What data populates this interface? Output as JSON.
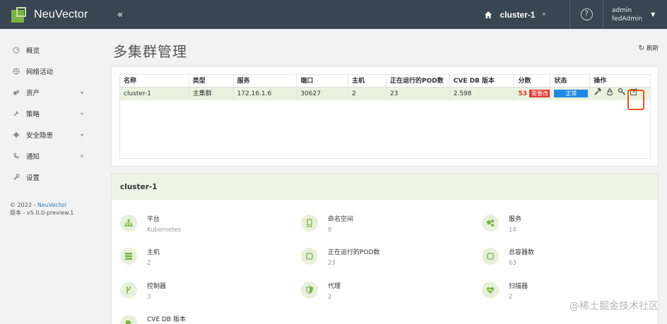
{
  "app": {
    "name": "NeuVector",
    "collapse_glyph": "«"
  },
  "topbar": {
    "cluster": "cluster-1",
    "help_glyph": "?",
    "user": "admin",
    "role": "fedAdmin"
  },
  "sidebar": {
    "items": [
      {
        "label": "概览",
        "icon": "dashboard-icon",
        "expandable": false
      },
      {
        "label": "网络活动",
        "icon": "network-icon",
        "expandable": false
      },
      {
        "label": "资产",
        "icon": "assets-icon",
        "expandable": true
      },
      {
        "label": "策略",
        "icon": "policy-icon",
        "expandable": true
      },
      {
        "label": "安全隐患",
        "icon": "security-icon",
        "expandable": true
      },
      {
        "label": "通知",
        "icon": "notification-icon",
        "expandable": true
      },
      {
        "label": "设置",
        "icon": "settings-icon",
        "expandable": false
      }
    ],
    "footer": {
      "copyright": "© 2022 -",
      "company": "NeuVector",
      "version": "版本 - v5.0.0-preview.1"
    }
  },
  "page": {
    "title": "多集群管理",
    "refresh_label": "刷新"
  },
  "cluster_table": {
    "columns": [
      "名称",
      "类型",
      "服务",
      "端口",
      "主机",
      "正在运行的POD数",
      "CVE DB 版本",
      "分数",
      "状态",
      "操作"
    ],
    "rows": [
      {
        "name": "cluster-1",
        "type": "主集群",
        "service": "172.16.1.6",
        "port": "30627",
        "hosts": "2",
        "pods": "23",
        "cve_db": "2.598",
        "score": "53",
        "score_badge": "需要改",
        "status": "正常"
      }
    ]
  },
  "cluster_detail": {
    "title": "cluster-1",
    "metrics": [
      {
        "label": "平台",
        "value": "Kubernetes",
        "icon": "platform-icon"
      },
      {
        "label": "命名空间",
        "value": "8",
        "icon": "namespace-icon"
      },
      {
        "label": "服务",
        "value": "14",
        "icon": "services-icon"
      },
      {
        "label": "主机",
        "value": "2",
        "icon": "host-icon"
      },
      {
        "label": "正在运行的POD数",
        "value": "23",
        "icon": "pod-icon"
      },
      {
        "label": "总容器数",
        "value": "63",
        "icon": "container-icon"
      },
      {
        "label": "控制器",
        "value": "3",
        "icon": "controller-icon"
      },
      {
        "label": "代理",
        "value": "2",
        "icon": "enforcer-icon"
      },
      {
        "label": "扫描器",
        "value": "2",
        "icon": "scanner-icon"
      },
      {
        "label": "CVE DB 版本",
        "value": "",
        "icon": "cve-db-icon"
      }
    ]
  },
  "watermark": "@稀土掘金技术社区",
  "colors": {
    "topbar": "#3a4553",
    "accent_green": "#7cb342",
    "row_highlight": "#eaf2de",
    "status_blue": "#1e88e5",
    "score_red": "#e53935",
    "highlight_box": "#e8541c"
  }
}
